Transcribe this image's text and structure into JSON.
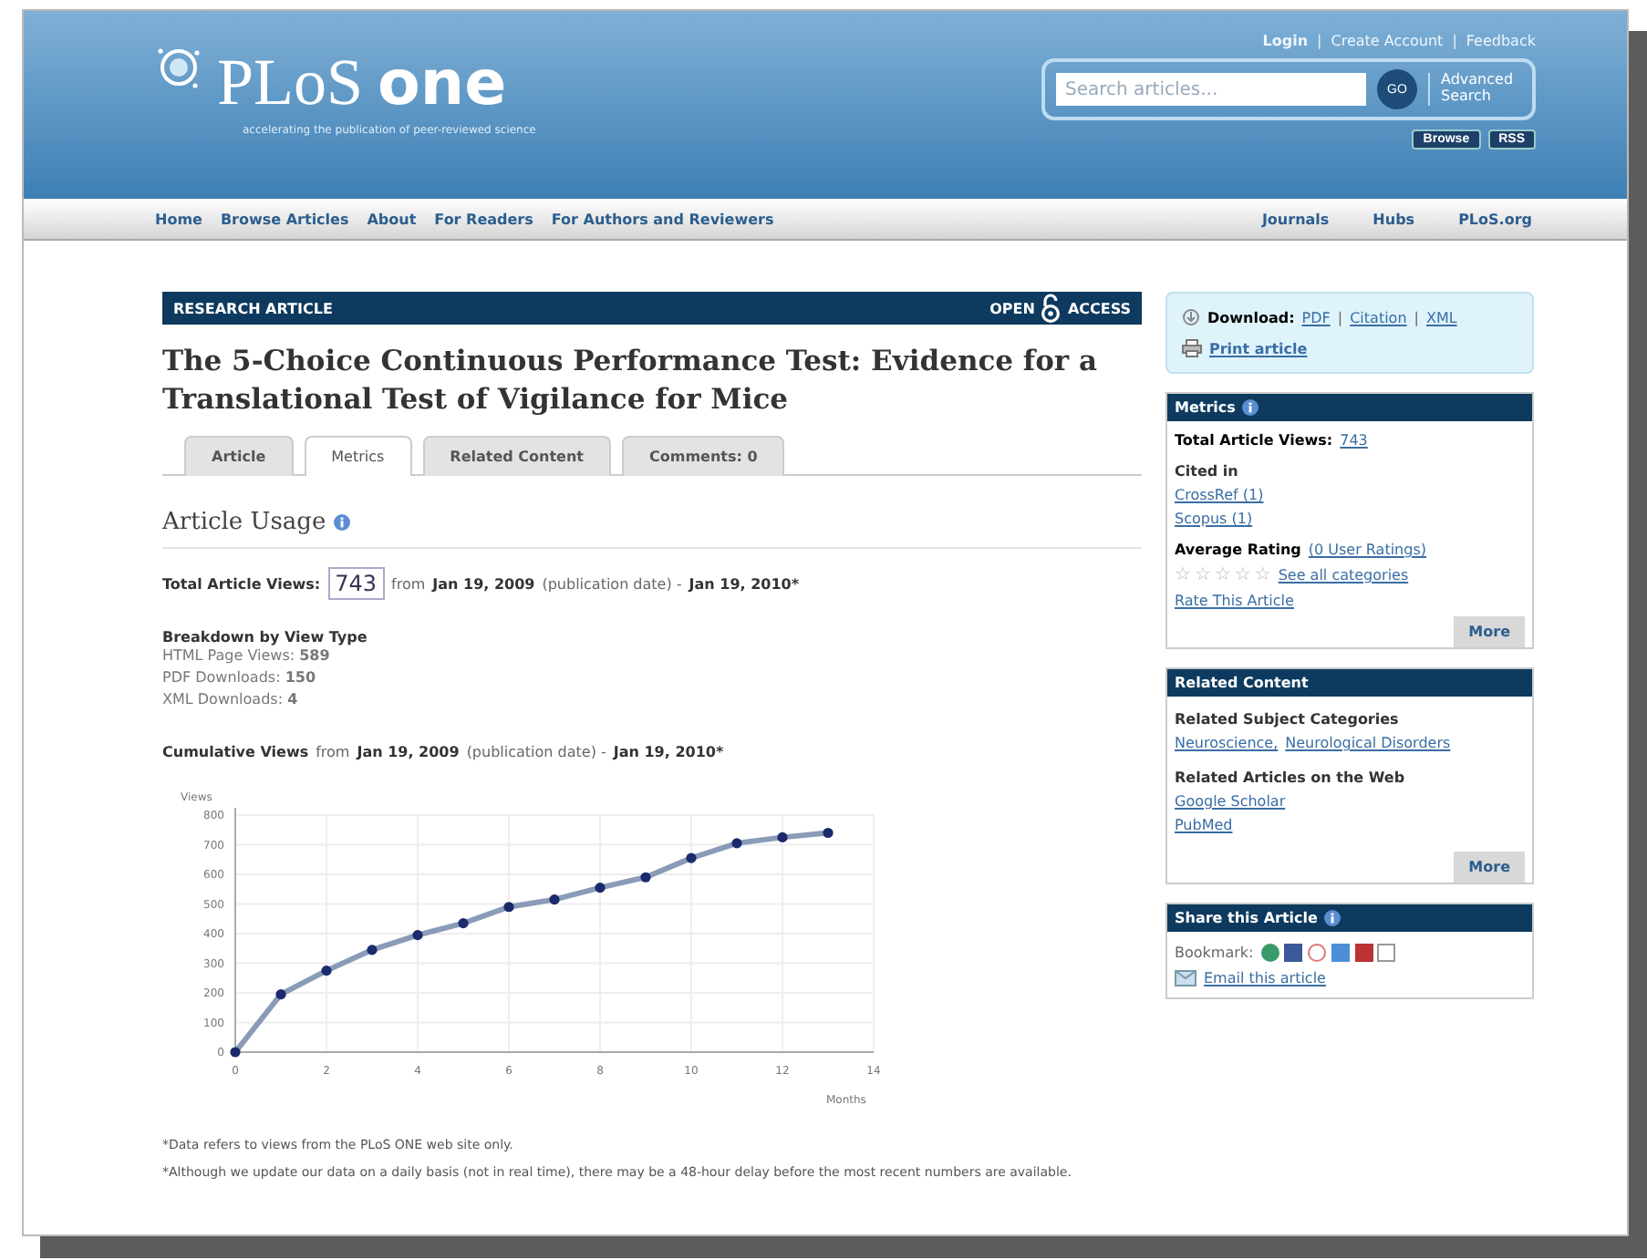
{
  "header": {
    "logo": {
      "first": "PLoS",
      "second": "one"
    },
    "tagline": "accelerating the publication of peer-reviewed science",
    "top_links": [
      {
        "label": "Login"
      },
      {
        "label": "Create Account"
      },
      {
        "label": "Feedback"
      }
    ],
    "separator": "|",
    "search": {
      "placeholder": "Search articles...",
      "go": "GO",
      "advanced": "Advanced Search"
    },
    "buttons": [
      "Browse",
      "RSS"
    ]
  },
  "nav": {
    "left": [
      "Home",
      "Browse Articles",
      "About",
      "For Readers",
      "For Authors and Reviewers"
    ],
    "right": [
      "Journals",
      "Hubs",
      "PLoS.org"
    ]
  },
  "article_bar": {
    "type": "RESEARCH ARTICLE",
    "open": "OPEN",
    "access": "ACCESS"
  },
  "title": "The 5-Choice Continuous Performance Test: Evidence for a Translational Test of Vigilance for Mice",
  "tabs": [
    {
      "label": "Article",
      "selected": false
    },
    {
      "label": "Metrics",
      "selected": true
    },
    {
      "label": "Related Content",
      "selected": false
    },
    {
      "label": "Comments: 0",
      "selected": false
    }
  ],
  "usage": {
    "heading": "Article Usage",
    "total_label": "Total Article Views:",
    "total_value": "743",
    "range": {
      "from": "from",
      "start": "Jan 19, 2009",
      "note": "(publication date) -",
      "end": "Jan 19, 2010*"
    },
    "breakdown_title": "Breakdown by View Type",
    "breakdown": [
      "HTML Page Views: **589**",
      "PDF Downloads: **150**",
      "XML Downloads: **4**"
    ],
    "cumulative_title": "Cumulative Views",
    "range2": {
      "from": "from",
      "start": "Jan 19, 2009",
      "note": "(publication date) -",
      "end": "Jan 19, 2010*"
    },
    "chart_data": {
      "type": "line",
      "xlabel": "Months",
      "ylabel": "Views",
      "x": [
        0,
        1,
        2,
        3,
        4,
        5,
        6,
        7,
        8,
        9,
        10,
        11,
        12,
        13
      ],
      "grid": true,
      "series": [
        {
          "color": "#1a2a6c",
          "marker": true,
          "values": [
            0,
            195,
            275,
            345,
            395,
            435,
            490,
            515,
            555,
            590,
            655,
            705,
            725,
            740
          ]
        }
      ],
      "xlim": [
        0,
        14
      ],
      "ylim": [
        0,
        800
      ],
      "xticks": [
        0,
        2,
        4,
        6,
        8,
        10,
        12,
        14
      ],
      "yticks": [
        0,
        100,
        200,
        300,
        400,
        500,
        600,
        700,
        800
      ]
    },
    "notes": [
      "*Data refers to views from the PLoS ONE web site only.",
      "*Although we update our data on a daily basis (not in real time), there may be a 48-hour delay before the most recent numbers are available."
    ]
  },
  "sidebar": {
    "download": {
      "label": "Download:",
      "links": [
        "PDF",
        "Citation",
        "XML"
      ],
      "print": "Print article"
    },
    "metrics": {
      "title": "Metrics",
      "total_label": "Total Article Views:",
      "total_value": "743",
      "cited_label": "Cited in",
      "cited": [
        "CrossRef (1)",
        "Scopus (1)"
      ],
      "rating_label": "Average Rating",
      "rating_count": "(0 User Ratings)",
      "rating": {
        "stars": 0
      },
      "see_all": "See all categories",
      "rate": "Rate This Article",
      "more": "More"
    },
    "related": {
      "title": "Related Content",
      "subjects_label": "Related Subject Categories",
      "subjects": [
        "Neuroscience,",
        "Neurological Disorders"
      ],
      "web_label": "Related Articles on the Web",
      "web": [
        "Google Scholar",
        "PubMed"
      ],
      "more": "More"
    },
    "share": {
      "title": "Share this Article",
      "bookmark": "Bookmark:",
      "email": "Email this article"
    }
  }
}
